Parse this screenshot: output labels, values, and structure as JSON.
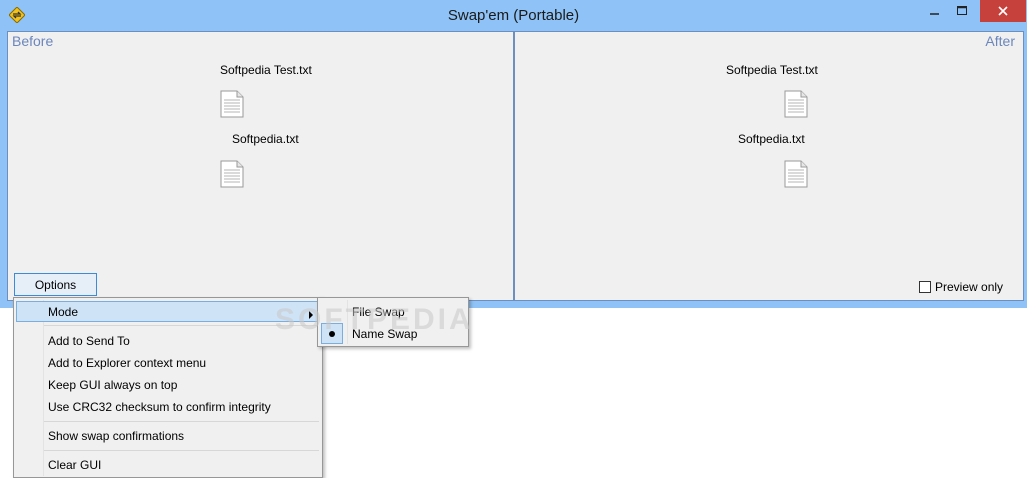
{
  "window": {
    "title": "Swap'em (Portable)",
    "controls": {
      "minimize": "–",
      "maximize": "□",
      "close": "✕"
    }
  },
  "before_panel": {
    "label": "Before",
    "files": [
      {
        "name": "Softpedia Test.txt",
        "icon": "text-file-icon"
      },
      {
        "name": "Softpedia.txt",
        "icon": "text-file-icon"
      }
    ]
  },
  "after_panel": {
    "label": "After",
    "files": [
      {
        "name": "Softpedia Test.txt",
        "icon": "text-file-icon"
      },
      {
        "name": "Softpedia.txt",
        "icon": "text-file-icon"
      }
    ]
  },
  "options_button": {
    "label": "Options"
  },
  "preview_only": {
    "label": "Preview only",
    "checked": false
  },
  "options_menu": {
    "items": [
      {
        "label": "Mode",
        "has_submenu": true,
        "highlighted": true
      },
      {
        "label": "Add to Send To"
      },
      {
        "label": "Add to Explorer context menu"
      },
      {
        "label": "Keep GUI always on top"
      },
      {
        "label": "Use CRC32 checksum to confirm integrity"
      },
      {
        "label": "Show swap confirmations"
      },
      {
        "label": "Clear GUI"
      }
    ]
  },
  "mode_submenu": {
    "items": [
      {
        "label": "File Swap",
        "selected": false
      },
      {
        "label": "Name Swap",
        "selected": true
      }
    ]
  },
  "watermark": "SOFTPEDIA",
  "colors": {
    "titlebar": "#8fc3f7",
    "panel_label": "#6b86bd",
    "close_button": "#c7413c",
    "menu_highlight": "#cfe3f7"
  }
}
